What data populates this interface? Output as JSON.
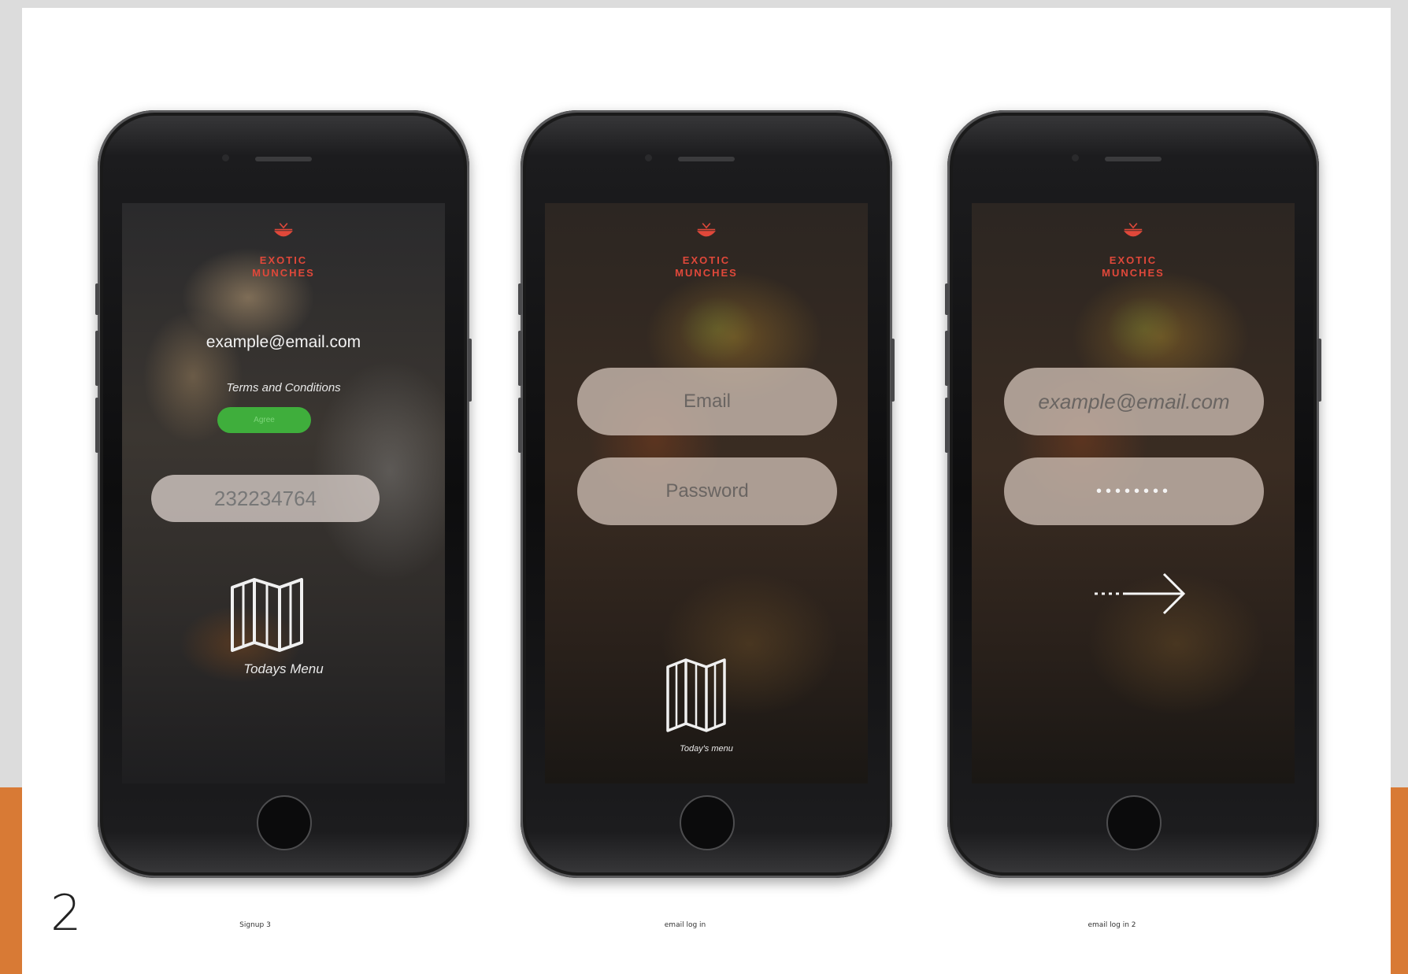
{
  "slide": {
    "number": "2"
  },
  "brand": {
    "line1": "EXOTIC",
    "line2": "MUNCHES",
    "accent_color": "#e0483a"
  },
  "screens": [
    {
      "caption": "Signup 3",
      "email": "example@email.com",
      "terms": "Terms and Conditions",
      "agree_label": "Agree",
      "phone_value": "232234764",
      "menu_label": "Todays Menu"
    },
    {
      "caption": "email log in",
      "email_placeholder": "Email",
      "password_placeholder": "Password",
      "menu_label": "Today's menu"
    },
    {
      "caption": "email log in 2",
      "email_value": "example@email.com",
      "password_value": "••••••••",
      "next_icon": "arrow-right-icon"
    }
  ],
  "colors": {
    "orange_bar": "#d87a35",
    "agree_green": "#3fae3c"
  }
}
